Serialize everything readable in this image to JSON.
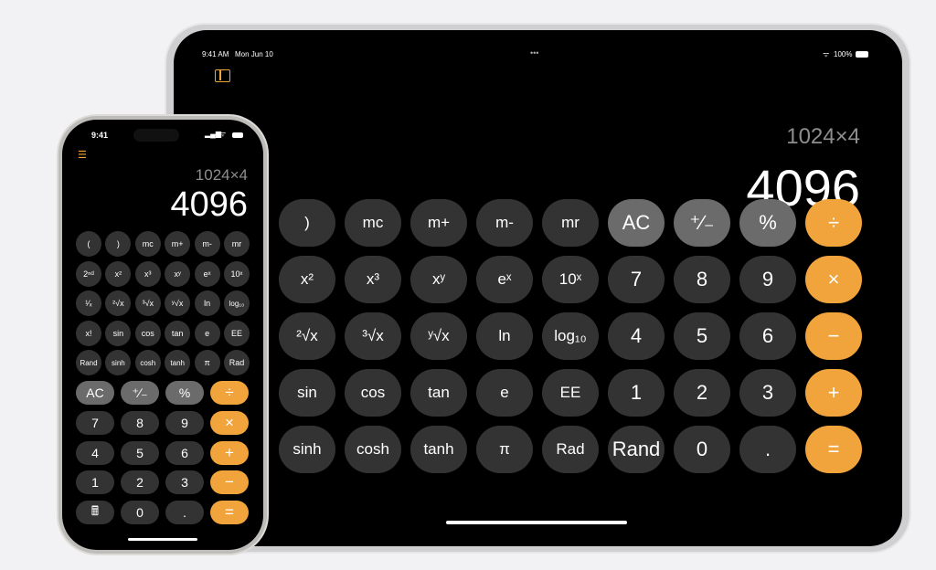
{
  "colors": {
    "digit": "#333333",
    "function": "#6b6b6b",
    "operator": "#f1a33c",
    "accent": "#f1a33c"
  },
  "ipad": {
    "status": {
      "time": "9:41 AM",
      "date": "Mon Jun 10",
      "dots": "•••",
      "battery": "100%"
    },
    "sidebar_icon": "sidebar-toggle-icon",
    "expression": "1024×4",
    "result": "4096",
    "rows": [
      [
        ")",
        "mc",
        "m+",
        "m-",
        "mr",
        "AC",
        "⁺∕₋",
        "%",
        "÷"
      ],
      [
        "x²",
        "x³",
        "xʸ",
        "eˣ",
        "10ˣ",
        "7",
        "8",
        "9",
        "×"
      ],
      [
        "²√x",
        "³√x",
        "ʸ√x",
        "ln",
        "log₁₀",
        "4",
        "5",
        "6",
        "−"
      ],
      [
        "sin",
        "cos",
        "tan",
        "e",
        "EE",
        "1",
        "2",
        "3",
        "+"
      ],
      [
        "sinh",
        "cosh",
        "tanh",
        "π",
        "Rad",
        "Rand",
        "0",
        ".",
        "="
      ]
    ]
  },
  "iphone": {
    "status": {
      "time": "9:41"
    },
    "menu_icon": "list-icon",
    "expression": "1024×4",
    "result": "4096",
    "sci_rows": [
      [
        "(",
        ")",
        "mc",
        "m+",
        "m-",
        "mr"
      ],
      [
        "2ⁿᵈ",
        "x²",
        "x³",
        "xʸ",
        "eˣ",
        "10ˣ"
      ],
      [
        "¹⁄ₓ",
        "²√x",
        "³√x",
        "ʸ√x",
        "ln",
        "log₁₀"
      ],
      [
        "x!",
        "sin",
        "cos",
        "tan",
        "e",
        "EE"
      ],
      [
        "Rand",
        "sinh",
        "cosh",
        "tanh",
        "π",
        "Rad"
      ]
    ],
    "basic_rows": [
      [
        "AC",
        "⁺∕₋",
        "%",
        "÷"
      ],
      [
        "7",
        "8",
        "9",
        "×"
      ],
      [
        "4",
        "5",
        "6",
        "+"
      ],
      [
        "1",
        "2",
        "3",
        "−"
      ],
      [
        "🖩",
        "0",
        ".",
        "="
      ]
    ]
  }
}
